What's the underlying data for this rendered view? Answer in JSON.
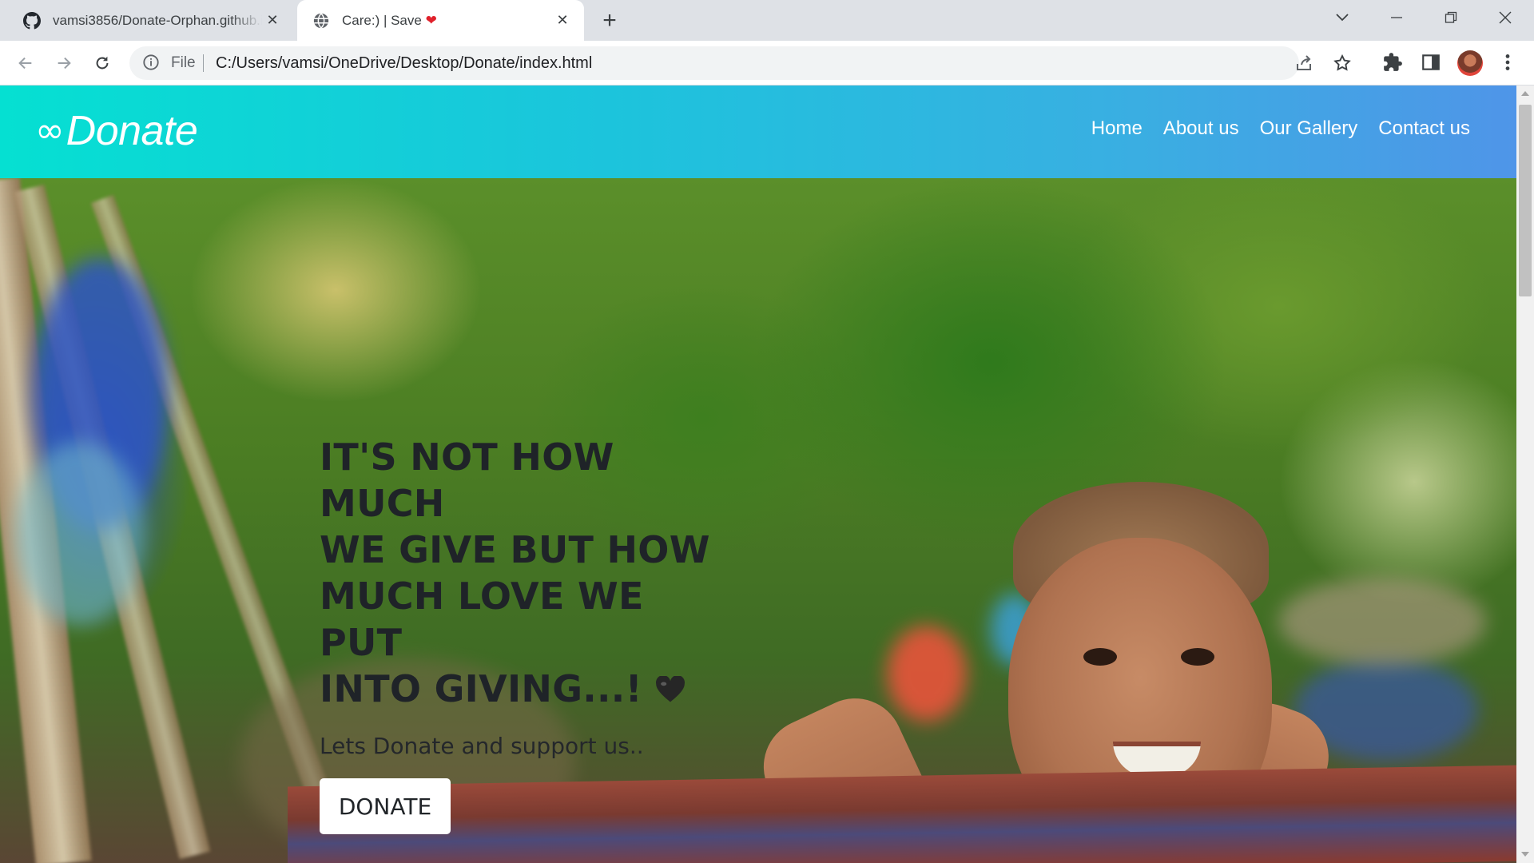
{
  "browser": {
    "tabs": [
      {
        "title": "vamsi3856/Donate-Orphan.github.io",
        "favicon": "github-icon",
        "active": false
      },
      {
        "title": "Care:) | Save",
        "favicon": "globe-icon",
        "active": true,
        "title_emoji": "❤"
      }
    ],
    "address_bar": {
      "scheme_label": "File",
      "url": "C:/Users/vamsi/OneDrive/Desktop/Donate/index.html"
    }
  },
  "site": {
    "brand": {
      "icon": "∞",
      "name": "Donate"
    },
    "nav": [
      "Home",
      "About us",
      "Our Gallery",
      "Contact us"
    ]
  },
  "hero": {
    "headline_lines": [
      "IT'S NOT HOW MUCH",
      "WE GIVE BUT HOW",
      "MUCH LOVE WE PUT",
      "INTO GIVING...!"
    ],
    "subline": "Lets Donate and support us..",
    "button_label": "DONATE"
  },
  "colors": {
    "navbar_start": "#05e0d2",
    "navbar_end": "#4f95e8",
    "headline": "#1f2328",
    "tab_active_bg": "#ffffff",
    "tabbar_bg": "#dee1e6"
  }
}
